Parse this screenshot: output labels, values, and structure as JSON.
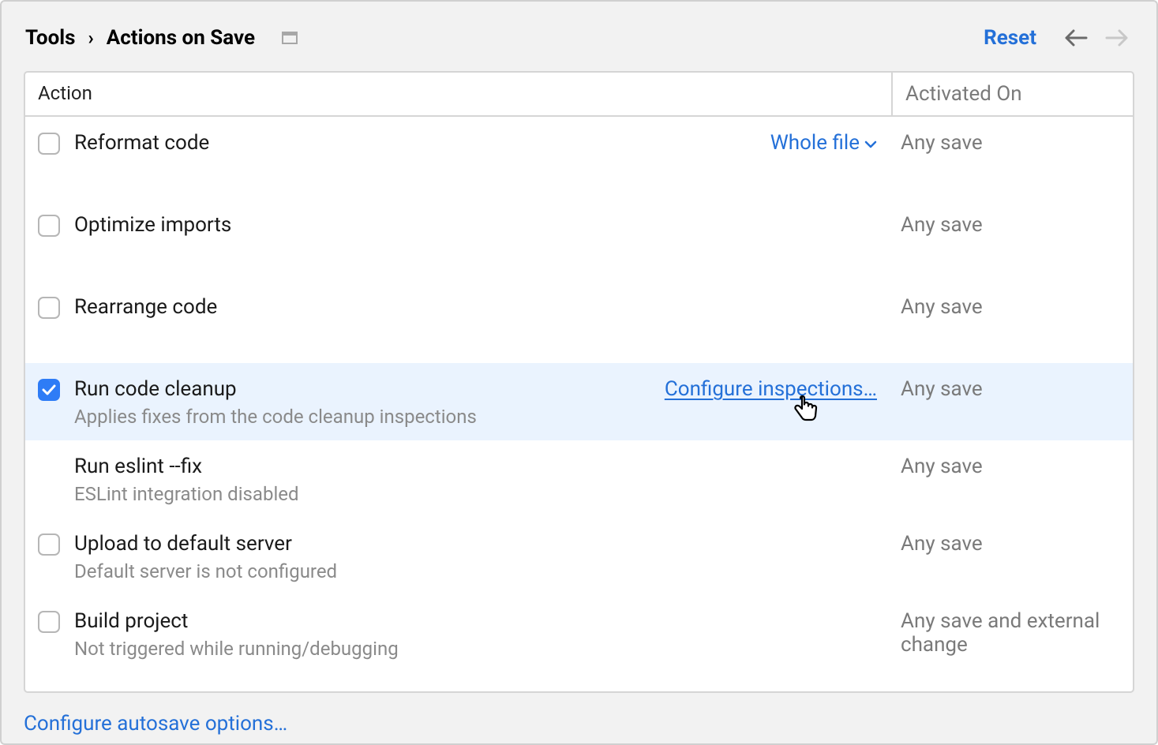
{
  "header": {
    "breadcrumb_parent": "Tools",
    "breadcrumb_current": "Actions on Save",
    "reset": "Reset"
  },
  "columns": {
    "action": "Action",
    "activated": "Activated On"
  },
  "rows": {
    "reformat": {
      "title": "Reformat code",
      "scope": "Whole file",
      "activated": "Any save"
    },
    "optimize": {
      "title": "Optimize imports",
      "activated": "Any save"
    },
    "rearrange": {
      "title": "Rearrange code",
      "activated": "Any save"
    },
    "cleanup": {
      "title": "Run code cleanup",
      "sub": "Applies fixes from the code cleanup inspections",
      "configure": "Configure inspections…",
      "activated": "Any save"
    },
    "eslint": {
      "title": "Run eslint --fix",
      "sub": "ESLint integration disabled",
      "activated": "Any save"
    },
    "upload": {
      "title": "Upload to default server",
      "sub": "Default server is not configured",
      "activated": "Any save"
    },
    "build": {
      "title": "Build project",
      "sub": "Not triggered while running/debugging",
      "activated": "Any save and external change"
    }
  },
  "footer": {
    "configure_autosave": "Configure autosave options…"
  }
}
